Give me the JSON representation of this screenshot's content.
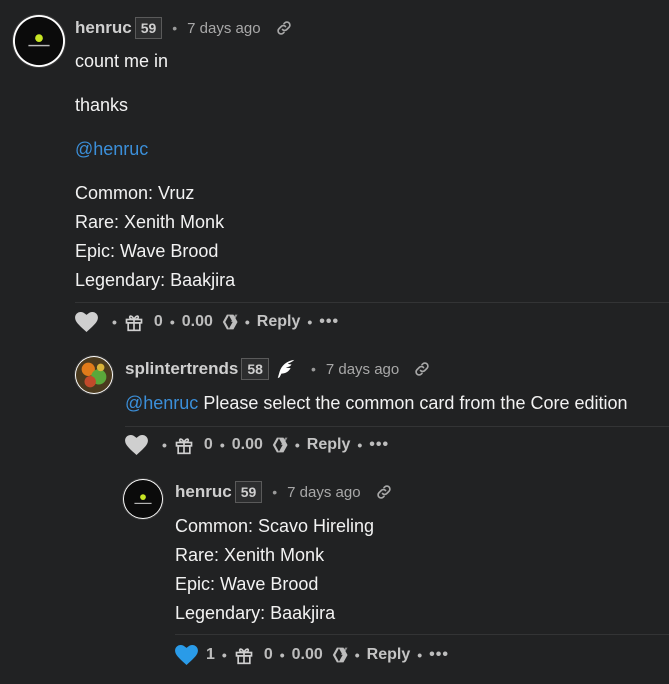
{
  "comments": [
    {
      "author": "henruc",
      "reputation": "59",
      "time": "7 days ago",
      "lines": [
        "count me in",
        "thanks"
      ],
      "mention": "@henruc",
      "card_lines": [
        "Common: Vruz",
        "Rare: Xenith Monk",
        "Epic: Wave Brood",
        "Legendary: Baakjira"
      ],
      "votes": "",
      "gifts": "0",
      "payout": "0.00",
      "reply_label": "Reply",
      "more_label": "•••"
    },
    {
      "author": "splintertrends",
      "reputation": "58",
      "time": "7 days ago",
      "mention": "@henruc",
      "text": " Please select the common card from the Core edition",
      "votes": "",
      "gifts": "0",
      "payout": "0.00",
      "reply_label": "Reply",
      "more_label": "•••"
    },
    {
      "author": "henruc",
      "reputation": "59",
      "time": "7 days ago",
      "card_lines": [
        "Common: Scavo Hireling",
        "Rare: Xenith Monk",
        "Epic: Wave Brood",
        "Legendary: Baakjira"
      ],
      "votes": "1",
      "gifts": "0",
      "payout": "0.00",
      "reply_label": "Reply",
      "more_label": "•••"
    }
  ],
  "colors": {
    "background": "#212223",
    "mention": "#3b8fd9",
    "liked_heart": "#2a9be8",
    "heart": "#cfcfcf"
  },
  "icons": [
    "heart-icon",
    "gift-icon",
    "hive-icon",
    "link-icon",
    "feather-icon"
  ],
  "separator": "•"
}
